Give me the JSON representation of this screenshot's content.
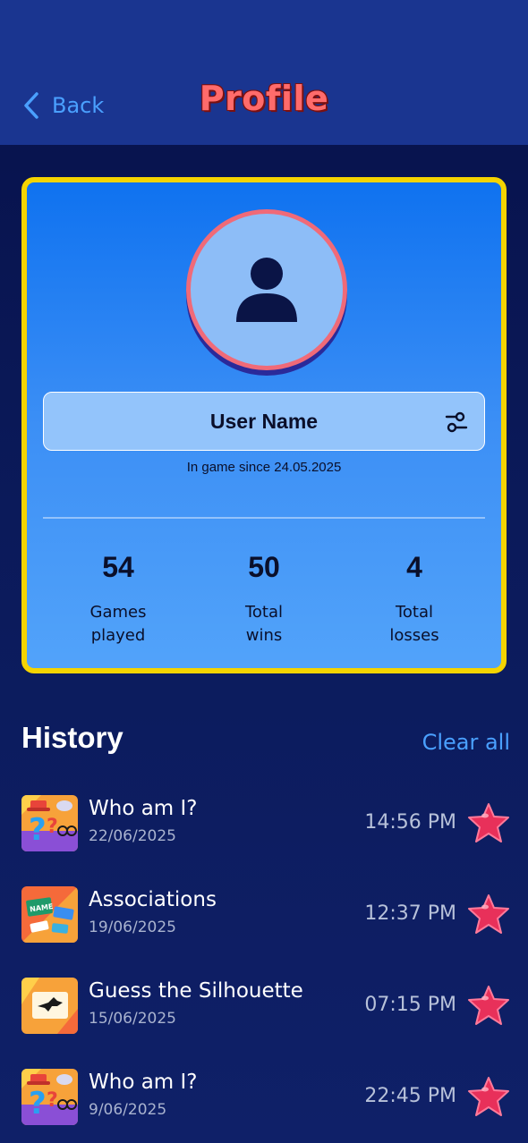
{
  "header": {
    "back_label": "Back",
    "title": "Profile"
  },
  "profile": {
    "user_name": "User Name",
    "since": "In game since 24.05.2025",
    "stats": [
      {
        "value": "54",
        "label": "Games\nplayed"
      },
      {
        "value": "50",
        "label": "Total\nwins"
      },
      {
        "value": "4",
        "label": "Total\nlosses"
      }
    ]
  },
  "history": {
    "title": "History",
    "clear_label": "Clear all",
    "items": [
      {
        "name": "Who am I?",
        "date": "22/06/2025",
        "time": "14:56 PM",
        "icon": "who-am-i-thumbnail",
        "favorite": true
      },
      {
        "name": "Associations",
        "date": "19/06/2025",
        "time": "12:37 PM",
        "icon": "associations-thumbnail",
        "favorite": true
      },
      {
        "name": "Guess the Silhouette",
        "date": "15/06/2025",
        "time": "07:15 PM",
        "icon": "silhouette-thumbnail",
        "favorite": true
      },
      {
        "name": "Who am I?",
        "date": "9/06/2025",
        "time": "22:45 PM",
        "icon": "who-am-i-thumbnail",
        "favorite": true
      }
    ]
  },
  "colors": {
    "accent": "#4aa0ff",
    "title": "#ff6b6b",
    "card_border": "#f5d400",
    "star": "#e8305a"
  }
}
